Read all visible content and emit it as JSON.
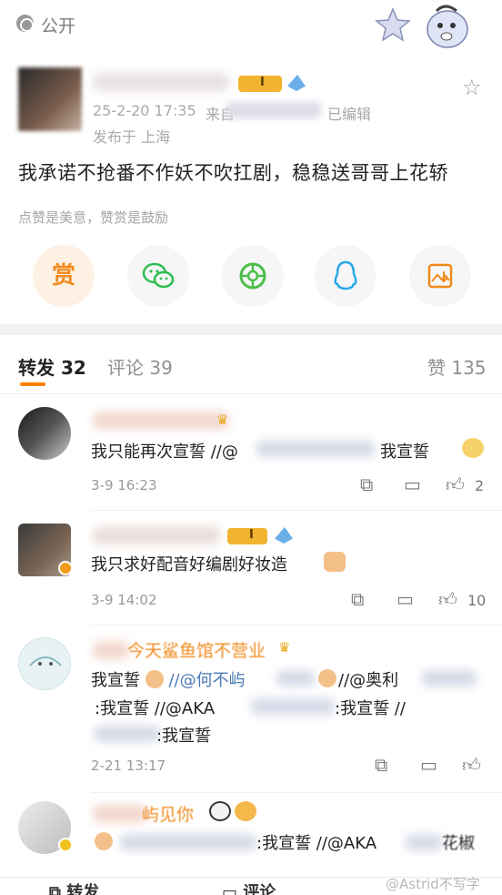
{
  "header": {
    "visibility_label": "公开"
  },
  "post": {
    "timestamp": "25-2-20 17:35",
    "source_prefix": "来自",
    "edited_label": "已编辑",
    "location": "发布于 上海",
    "vip_level": "I",
    "body": "我承诺不抢番不作妖不吹扛剧，稳稳送哥哥上花轿",
    "reward_hint": "点赞是美意，赞赏是鼓励",
    "share": {
      "reward_label": "赏"
    }
  },
  "tabs": {
    "reposts_label": "转发",
    "reposts_count": "32",
    "comments_label": "评论",
    "comments_count": "39",
    "likes_label": "赞",
    "likes_count": "135"
  },
  "comments": [
    {
      "text_before": "我只能再次宣誓 //@",
      "text_after": "我宣誓",
      "time": "3-9 16:23",
      "likes": "2"
    },
    {
      "vip_level": "I",
      "text": "我只求好配音好编剧好妆造",
      "time": "3-9 14:02",
      "likes": "10"
    },
    {
      "name_partial": "今天鲨鱼馆不营业",
      "line1_a": "我宣誓",
      "line1_b": "//@何不屿",
      "line1_c": "//@奥利",
      "line2_a": ":我宣誓 //@AKA",
      "line2_b": ":我宣誓 //",
      "line3": ":我宣誓",
      "time": "2-21 13:17"
    },
    {
      "name_partial": "屿见你",
      "text_a": ":我宣誓 //@AKA",
      "text_b": "花椒"
    }
  ],
  "bottom_bar": {
    "repost_label": "转发",
    "comment_label": "评论"
  },
  "watermark": "@Astrid不写字"
}
